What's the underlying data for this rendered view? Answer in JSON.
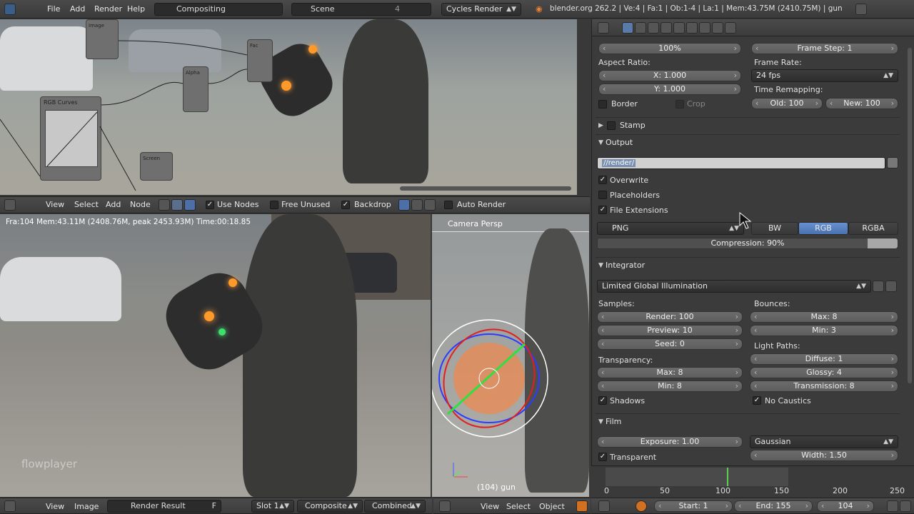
{
  "topbar": {
    "menus": [
      "File",
      "Add",
      "Render",
      "Help"
    ],
    "screen_layout": "Compositing",
    "scene": "Scene",
    "scene_num": "4",
    "engine": "Cycles Render",
    "info": "blender.org 262.2 | Ve:4 | Fa:1 | Ob:1-4 | La:1 | Mem:43.75M (2410.75M) | gun"
  },
  "node_editor": {
    "menus": [
      "View",
      "Select",
      "Add",
      "Node"
    ],
    "use_nodes": "Use Nodes",
    "free_unused": "Free Unused",
    "backdrop": "Backdrop",
    "auto_render": "Auto Render",
    "nodes": [
      "RGB Curves",
      "Screen",
      "Image",
      "Alpha",
      "Fac"
    ]
  },
  "image_editor": {
    "stats": "Fra:104  Mem:43.11M (2408.76M, peak 2453.93M) Time:00:18.85",
    "watermark": "flowplayer",
    "menus": [
      "View",
      "Image"
    ],
    "image_name": "Render Result",
    "f_label": "F",
    "slot": "Slot 1",
    "pass": "Composite",
    "layer": "Combined"
  },
  "view3d": {
    "label": "Camera Persp",
    "object_info": "(104) gun",
    "menus": [
      "View",
      "Select",
      "Object"
    ]
  },
  "properties": {
    "res_pct": "100%",
    "frame_step": "Frame Step: 1",
    "aspect_label": "Aspect Ratio:",
    "aspect_x": "X: 1.000",
    "aspect_y": "Y: 1.000",
    "frame_rate_label": "Frame Rate:",
    "frame_rate": "24 fps",
    "time_remap_label": "Time Remapping:",
    "old": "Old: 100",
    "new": "New: 100",
    "border": "Border",
    "crop": "Crop",
    "stamp": "Stamp",
    "output": "Output",
    "output_path": "//render/",
    "overwrite": "Overwrite",
    "placeholders": "Placeholders",
    "file_ext": "File Extensions",
    "format": "PNG",
    "color_modes": [
      "BW",
      "RGB",
      "RGBA"
    ],
    "compression": "Compression: 90%",
    "compression_value": 0.9,
    "integrator": "Integrator",
    "preset": "Limited Global Illumination",
    "samples_label": "Samples:",
    "render": "Render: 100",
    "preview": "Preview: 10",
    "seed": "Seed: 0",
    "bounces_label": "Bounces:",
    "b_max": "Max: 8",
    "b_min": "Min: 3",
    "transparency_label": "Transparency:",
    "t_max": "Max: 8",
    "t_min": "Min: 8",
    "light_paths_label": "Light Paths:",
    "diffuse": "Diffuse: 1",
    "glossy": "Glossy: 4",
    "transmission": "Transmission: 8",
    "shadows": "Shadows",
    "no_caustics": "No Caustics",
    "film": "Film",
    "exposure": "Exposure: 1.00",
    "filter": "Gaussian",
    "transparent": "Transparent",
    "width": "Width: 1.50"
  },
  "timeline": {
    "ticks": [
      "0",
      "50",
      "100",
      "150",
      "200",
      "250"
    ],
    "start": "Start: 1",
    "end": "End: 155",
    "current": "104"
  }
}
